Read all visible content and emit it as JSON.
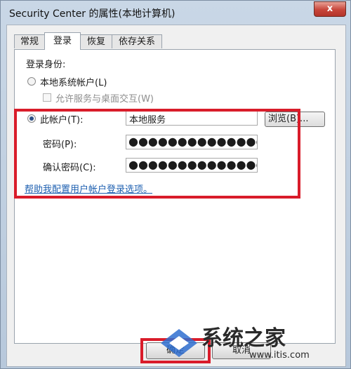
{
  "window": {
    "title": "Security Center 的属性(本地计算机)",
    "close_label": "x"
  },
  "tabs": [
    {
      "label": "常规",
      "active": false
    },
    {
      "label": "登录",
      "active": true
    },
    {
      "label": "恢复",
      "active": false
    },
    {
      "label": "依存关系",
      "active": false
    }
  ],
  "logon": {
    "section_label": "登录身份:",
    "local_system_label": "本地系统帐户(L)",
    "allow_desktop_label": "允许服务与桌面交互(W)",
    "this_account_label": "此帐户(T):",
    "account_value": "本地服务",
    "browse_label": "浏览(B)...",
    "password_label": "密码(P):",
    "password_value": "●●●●●●●●●●●●●●●",
    "confirm_label": "确认密码(C):",
    "confirm_value": "●●●●●●●●●●●●●●●",
    "help_link": "帮助我配置用户帐户登录选项。"
  },
  "footer": {
    "ok_label": "确定",
    "cancel_label": "取消"
  },
  "watermark": {
    "brand": "系统之家",
    "url": "www.itis.com"
  },
  "colors": {
    "highlight_red": "#d91c2a",
    "link_blue": "#1d5fb0"
  }
}
